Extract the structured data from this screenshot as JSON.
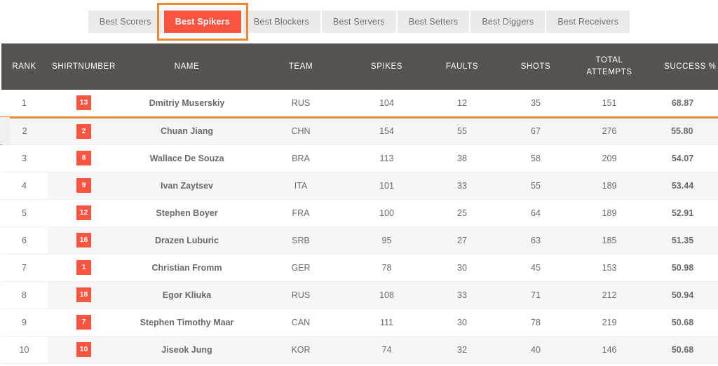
{
  "tabs": {
    "items": [
      {
        "label": "Best Scorers",
        "active": false
      },
      {
        "label": "Best Spikers",
        "active": true
      },
      {
        "label": "Best Blockers",
        "active": false
      },
      {
        "label": "Best Servers",
        "active": false
      },
      {
        "label": "Best Setters",
        "active": false
      },
      {
        "label": "Best Diggers",
        "active": false
      },
      {
        "label": "Best Receivers",
        "active": false
      }
    ],
    "active_label": "Best Spikers"
  },
  "colors": {
    "accent_red": "#fb5440",
    "focus_orange": "#ed8733",
    "header_bg": "#58534f",
    "rank_text": "#f96d52",
    "row_alt_bg": "#f7f6f6",
    "tab_bg": "#eceaea"
  },
  "table": {
    "columns": [
      "RANK",
      "SHIRTNUMBER",
      "NAME",
      "TEAM",
      "SPIKES",
      "FAULTS",
      "SHOTS",
      "TOTAL ATTEMPTS",
      "SUCCESS %"
    ],
    "column_total_attempts_line1": "TOTAL",
    "column_total_attempts_line2": "ATTEMPTS",
    "highlighted_row_index": 1,
    "rows": [
      {
        "rank": "1",
        "shirt": "13",
        "name": "Dmitriy Muserskiy",
        "team": "RUS",
        "spikes": "104",
        "faults": "12",
        "shots": "35",
        "total": "151",
        "success": "68.87"
      },
      {
        "rank": "2",
        "shirt": "2",
        "name": "Chuan Jiang",
        "team": "CHN",
        "spikes": "154",
        "faults": "55",
        "shots": "67",
        "total": "276",
        "success": "55.80"
      },
      {
        "rank": "3",
        "shirt": "8",
        "name": "Wallace De Souza",
        "team": "BRA",
        "spikes": "113",
        "faults": "38",
        "shots": "58",
        "total": "209",
        "success": "54.07"
      },
      {
        "rank": "4",
        "shirt": "9",
        "name": "Ivan Zaytsev",
        "team": "ITA",
        "spikes": "101",
        "faults": "33",
        "shots": "55",
        "total": "189",
        "success": "53.44"
      },
      {
        "rank": "5",
        "shirt": "12",
        "name": "Stephen Boyer",
        "team": "FRA",
        "spikes": "100",
        "faults": "25",
        "shots": "64",
        "total": "189",
        "success": "52.91"
      },
      {
        "rank": "6",
        "shirt": "16",
        "name": "Drazen Luburic",
        "team": "SRB",
        "spikes": "95",
        "faults": "27",
        "shots": "63",
        "total": "185",
        "success": "51.35"
      },
      {
        "rank": "7",
        "shirt": "1",
        "name": "Christian Fromm",
        "team": "GER",
        "spikes": "78",
        "faults": "30",
        "shots": "45",
        "total": "153",
        "success": "50.98"
      },
      {
        "rank": "8",
        "shirt": "18",
        "name": "Egor Kliuka",
        "team": "RUS",
        "spikes": "108",
        "faults": "33",
        "shots": "71",
        "total": "212",
        "success": "50.94"
      },
      {
        "rank": "9",
        "shirt": "7",
        "name": "Stephen Timothy Maar",
        "team": "CAN",
        "spikes": "111",
        "faults": "30",
        "shots": "78",
        "total": "219",
        "success": "50.68"
      },
      {
        "rank": "10",
        "shirt": "10",
        "name": "Jiseok Jung",
        "team": "KOR",
        "spikes": "74",
        "faults": "32",
        "shots": "40",
        "total": "146",
        "success": "50.68"
      }
    ]
  }
}
